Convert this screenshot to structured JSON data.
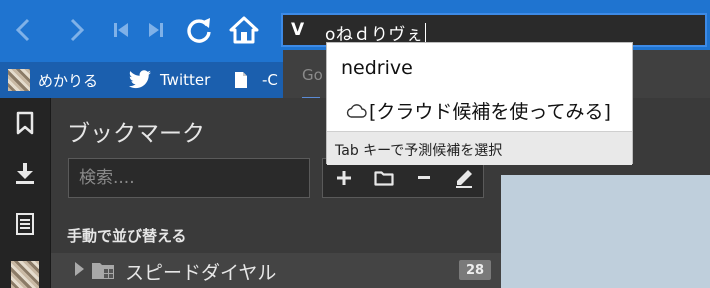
{
  "toolbar": {
    "back_icon": "chevron-left-icon",
    "forward_icon": "chevron-right-icon",
    "rewind_icon": "skip-start-icon",
    "fastforward_icon": "skip-end-icon",
    "reload_icon": "reload-icon",
    "home_icon": "home-icon",
    "accent": "#1f74d0"
  },
  "urlbar": {
    "prefix": "V",
    "text": "oねｄりヴぇ"
  },
  "bookmark_bar": {
    "items": [
      {
        "label": "めかりる"
      },
      {
        "label": "Twitter"
      },
      {
        "label": "-C"
      }
    ]
  },
  "autocomplete": {
    "behind_label": "Go",
    "behind_icon": "g"
  },
  "dropdown": {
    "item1": "nedrive",
    "item2": "[クラウド候補を使ってみる]",
    "hint": "Tab キーで予測候補を選択"
  },
  "panel": {
    "title": "ブックマーク",
    "search_placeholder": "検索....",
    "sort_label": "手動で並び替える",
    "speed_dial": {
      "label": "スピードダイヤル",
      "count": "28"
    }
  }
}
